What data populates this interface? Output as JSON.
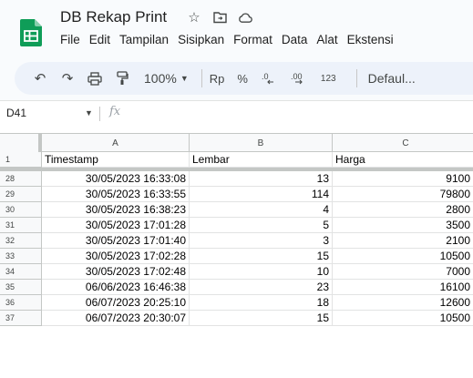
{
  "app": {
    "doc_title": "DB Rekap Print",
    "brand_color": "#0f9d58",
    "title_icons": [
      "star-icon",
      "move-to-folder-icon",
      "cloud-status-icon"
    ]
  },
  "menu": {
    "items": [
      "File",
      "Edit",
      "Tampilan",
      "Sisipkan",
      "Format",
      "Data",
      "Alat",
      "Ekstensi"
    ]
  },
  "toolbar": {
    "undo_icon": "↶",
    "redo_icon": "↷",
    "print_icon": "⎙",
    "paint_format_icon": "⛏",
    "zoom": "100%",
    "currency": "Rp",
    "percent": "%",
    "decrease_decimal": ".0←",
    "increase_decimal": ".00→",
    "number_format": "123",
    "font": "Defaul..."
  },
  "formula_bar": {
    "cell_ref": "D41",
    "fx": "fx",
    "value": ""
  },
  "sheet": {
    "columns": [
      "A",
      "B",
      "C"
    ],
    "header_row": {
      "row": "1",
      "cells": [
        "Timestamp",
        "Lembar",
        "Harga"
      ]
    },
    "rows": [
      {
        "row": "28",
        "timestamp": "30/05/2023 16:33:08",
        "lembar": "13",
        "harga": "9100"
      },
      {
        "row": "29",
        "timestamp": "30/05/2023 16:33:55",
        "lembar": "114",
        "harga": "79800"
      },
      {
        "row": "30",
        "timestamp": "30/05/2023 16:38:23",
        "lembar": "4",
        "harga": "2800"
      },
      {
        "row": "31",
        "timestamp": "30/05/2023 17:01:28",
        "lembar": "5",
        "harga": "3500"
      },
      {
        "row": "32",
        "timestamp": "30/05/2023 17:01:40",
        "lembar": "3",
        "harga": "2100"
      },
      {
        "row": "33",
        "timestamp": "30/05/2023 17:02:28",
        "lembar": "15",
        "harga": "10500"
      },
      {
        "row": "34",
        "timestamp": "30/05/2023 17:02:48",
        "lembar": "10",
        "harga": "7000"
      },
      {
        "row": "35",
        "timestamp": "06/06/2023 16:46:38",
        "lembar": "23",
        "harga": "16100"
      },
      {
        "row": "36",
        "timestamp": "06/07/2023 20:25:10",
        "lembar": "18",
        "harga": "12600"
      },
      {
        "row": "37",
        "timestamp": "06/07/2023 20:30:07",
        "lembar": "15",
        "harga": "10500"
      }
    ]
  }
}
